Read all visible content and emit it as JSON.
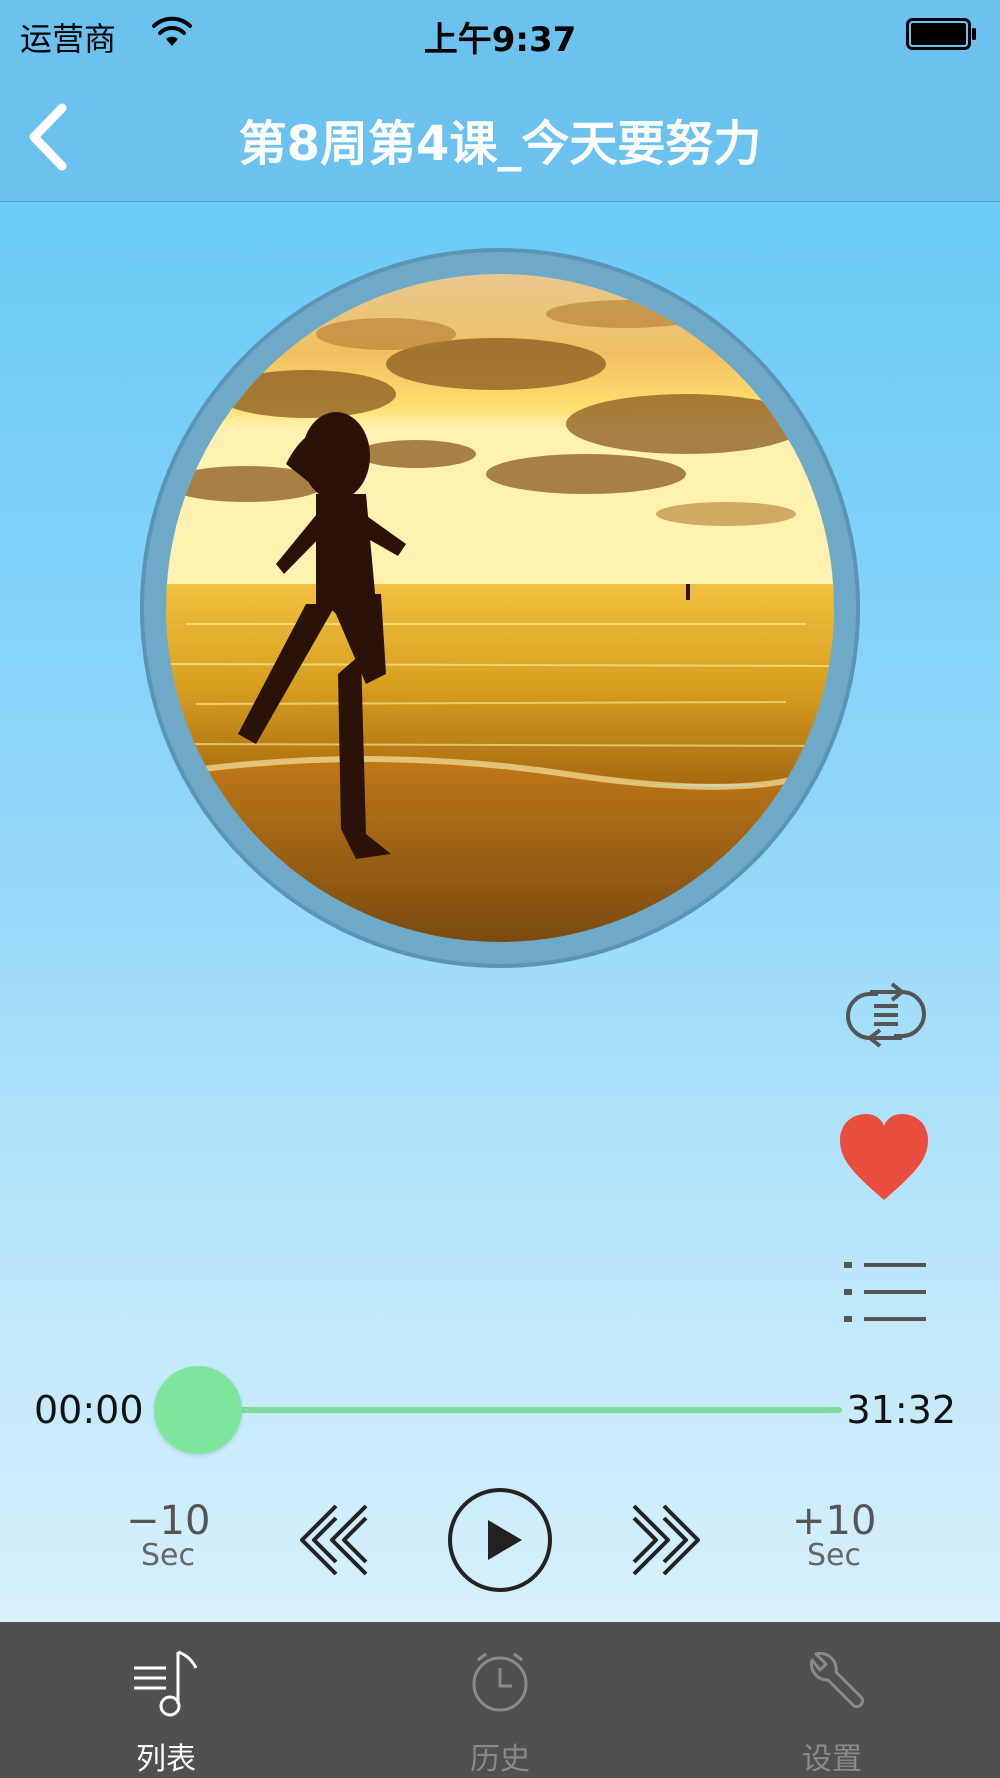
{
  "status_bar": {
    "carrier": "运营商",
    "time": "上午9:37"
  },
  "nav": {
    "title": "第8周第4课_今天要努力"
  },
  "player": {
    "current_time": "00:00",
    "total_time": "31:32",
    "progress": 0,
    "skip_back_label": "−10",
    "skip_back_unit": "Sec",
    "skip_forward_label": "+10",
    "skip_forward_unit": "Sec",
    "favorited": true,
    "colors": {
      "accent_green": "#7ee69c",
      "heart_red": "#e84d3d"
    }
  },
  "tabs": [
    {
      "label": "列表",
      "icon": "music-list-icon",
      "active": true
    },
    {
      "label": "历史",
      "icon": "clock-icon",
      "active": false
    },
    {
      "label": "设置",
      "icon": "wrench-icon",
      "active": false
    }
  ]
}
